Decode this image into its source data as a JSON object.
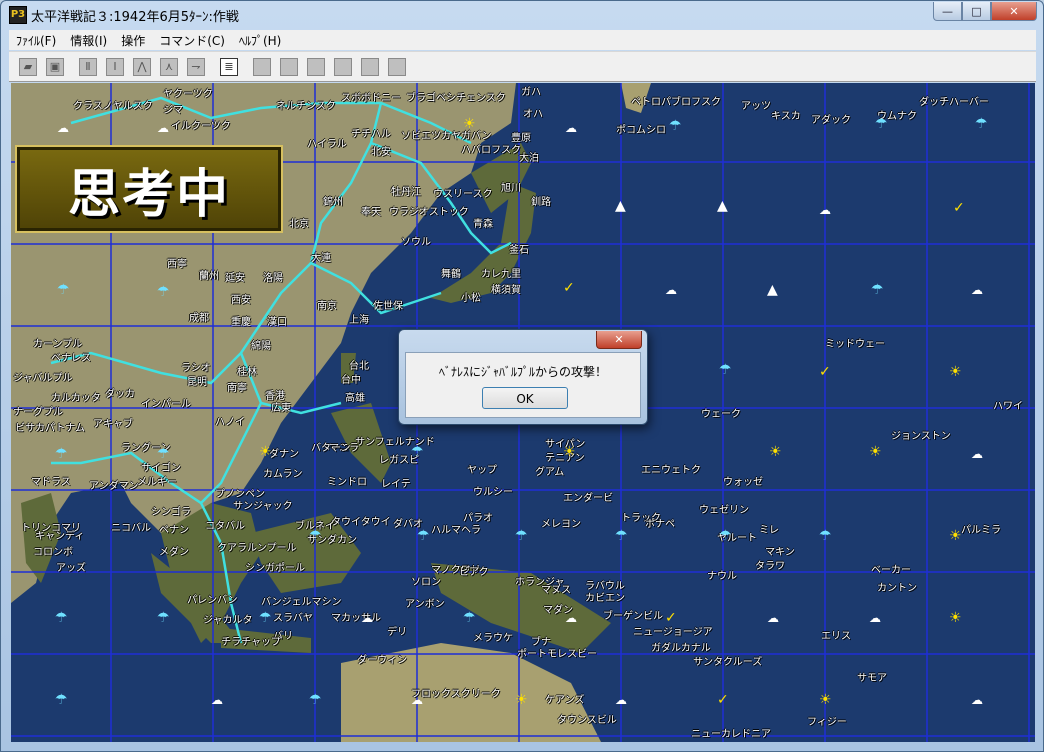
{
  "window": {
    "title": "太平洋戦記３:1942年6月5ﾀｰﾝ:作戦",
    "app_icon_text": "P3",
    "controls": {
      "minimize": "—",
      "maximize": "□",
      "close": "✕"
    }
  },
  "menu": [
    {
      "label": "ﾌｧｲﾙ(F)"
    },
    {
      "label": "情報(I)"
    },
    {
      "label": "操作"
    },
    {
      "label": "コマンド(C)"
    },
    {
      "label": "ﾍﾙﾌﾟ(H)"
    }
  ],
  "toolbar": {
    "buttons": [
      {
        "name": "open-icon",
        "glyph": "▰"
      },
      {
        "name": "save-icon",
        "glyph": "▣"
      },
      {
        "name": "unit-list-icon",
        "glyph": "Ⅱ"
      },
      {
        "name": "unit-list2-icon",
        "glyph": "Ⅰ"
      },
      {
        "name": "move-icon",
        "glyph": "⋀"
      },
      {
        "name": "move2-icon",
        "glyph": "⋏"
      },
      {
        "name": "arrow-icon",
        "glyph": "⇁"
      },
      {
        "name": "document-icon",
        "glyph": "≣"
      },
      {
        "name": "blank1-icon",
        "glyph": ""
      },
      {
        "name": "blank2-icon",
        "glyph": ""
      },
      {
        "name": "blank3-icon",
        "glyph": ""
      },
      {
        "name": "blank4-icon",
        "glyph": ""
      },
      {
        "name": "blank5-icon",
        "glyph": ""
      },
      {
        "name": "blank6-icon",
        "glyph": ""
      }
    ]
  },
  "status_overlay": {
    "text": "思考中"
  },
  "dialog": {
    "close": "✕",
    "message": "ﾍﾞﾅﾚｽにｼﾞｬﾊﾞﾙﾌﾟﾙからの攻撃！",
    "ok_label": "OK"
  },
  "map": {
    "place_labels": [
      {
        "text": "ヤクーツク"
      },
      {
        "text": "ガハ"
      },
      {
        "text": "ペトロパブロフスク"
      },
      {
        "text": "アッツ"
      },
      {
        "text": "キスカ"
      },
      {
        "text": "アダック"
      },
      {
        "text": "ウムナク"
      },
      {
        "text": "ダッチハーバー"
      },
      {
        "text": "クラスノヤルスク"
      },
      {
        "text": "ジマ"
      },
      {
        "text": "イルクーツク"
      },
      {
        "text": "ネルチンスク"
      },
      {
        "text": "スボボドニー"
      },
      {
        "text": "ブラゴベシチェンスク"
      },
      {
        "text": "ハバロフスク"
      },
      {
        "text": "ソビエツカヤガバン"
      },
      {
        "text": "オハ"
      },
      {
        "text": "ポコムシロ"
      },
      {
        "text": "大泊"
      },
      {
        "text": "豊原"
      },
      {
        "text": "ハイラル"
      },
      {
        "text": "チチハル"
      },
      {
        "text": "北安"
      },
      {
        "text": "牡丹江"
      },
      {
        "text": "ウスリースク"
      },
      {
        "text": "ウラジオストック"
      },
      {
        "text": "旭川"
      },
      {
        "text": "釧路"
      },
      {
        "text": "青森"
      },
      {
        "text": "錦州"
      },
      {
        "text": "奉天"
      },
      {
        "text": "北京"
      },
      {
        "text": "大連"
      },
      {
        "text": "ソウル"
      },
      {
        "text": "釜石"
      },
      {
        "text": "舞鶴"
      },
      {
        "text": "カレ九里"
      },
      {
        "text": "横須賀"
      },
      {
        "text": "佐世保"
      },
      {
        "text": "小松"
      },
      {
        "text": "西寧"
      },
      {
        "text": "蘭州"
      },
      {
        "text": "延安"
      },
      {
        "text": "洛陽"
      },
      {
        "text": "西安"
      },
      {
        "text": "南京"
      },
      {
        "text": "上海"
      },
      {
        "text": "成都"
      },
      {
        "text": "重慶"
      },
      {
        "text": "漢口"
      },
      {
        "text": "綿陽"
      },
      {
        "text": "ミッドウェー"
      },
      {
        "text": "カーンプル"
      },
      {
        "text": "ベナレス"
      },
      {
        "text": "ジャバルプル"
      },
      {
        "text": "カルカッタ"
      },
      {
        "text": "ダッカ"
      },
      {
        "text": "インパール"
      },
      {
        "text": "ラシオ"
      },
      {
        "text": "昆明"
      },
      {
        "text": "桂林"
      },
      {
        "text": "台北"
      },
      {
        "text": "台中"
      },
      {
        "text": "高雄"
      },
      {
        "text": "香港"
      },
      {
        "text": "広東"
      },
      {
        "text": "南寧"
      },
      {
        "text": "ウェーク"
      },
      {
        "text": "ハワイ"
      },
      {
        "text": "ナーグプル"
      },
      {
        "text": "ビサカパトナム"
      },
      {
        "text": "アキャブ"
      },
      {
        "text": "ラングーン"
      },
      {
        "text": "ハノイ"
      },
      {
        "text": "ダナン"
      },
      {
        "text": "マニラ"
      },
      {
        "text": "バターン"
      },
      {
        "text": "サンフェルナンド"
      },
      {
        "text": "レガスピ"
      },
      {
        "text": "ミンドロ"
      },
      {
        "text": "レイテ"
      },
      {
        "text": "サイパン"
      },
      {
        "text": "テニアン"
      },
      {
        "text": "グアム"
      },
      {
        "text": "ヤップ"
      },
      {
        "text": "エニウェトク"
      },
      {
        "text": "ウォッゼ"
      },
      {
        "text": "ジョンストン"
      },
      {
        "text": "マドラス"
      },
      {
        "text": "アンダマン"
      },
      {
        "text": "メルギー"
      },
      {
        "text": "サイゴン"
      },
      {
        "text": "カムラン"
      },
      {
        "text": "プノンペン"
      },
      {
        "text": "サンジャック"
      },
      {
        "text": "ウルシー"
      },
      {
        "text": "エンダービ"
      },
      {
        "text": "ウェゼリン"
      },
      {
        "text": "トリンコマリ"
      },
      {
        "text": "キャンディ"
      },
      {
        "text": "コロンボ"
      },
      {
        "text": "アッズ"
      },
      {
        "text": "ニコバル"
      },
      {
        "text": "シンゴラ"
      },
      {
        "text": "ペナン"
      },
      {
        "text": "コタバル"
      },
      {
        "text": "クアラルンプール"
      },
      {
        "text": "メダン"
      },
      {
        "text": "ブルネイ"
      },
      {
        "text": "サンダカン"
      },
      {
        "text": "シンガポール"
      },
      {
        "text": "タウイタウイ"
      },
      {
        "text": "ダバオ"
      },
      {
        "text": "ハルマヘラ"
      },
      {
        "text": "パラオ"
      },
      {
        "text": "メレヨン"
      },
      {
        "text": "トラック"
      },
      {
        "text": "ポナペ"
      },
      {
        "text": "ヤルート"
      },
      {
        "text": "マキン"
      },
      {
        "text": "タラワ"
      },
      {
        "text": "ミレ"
      },
      {
        "text": "パルミラ"
      },
      {
        "text": "ベーカー"
      },
      {
        "text": "ナウル"
      },
      {
        "text": "パレンバン"
      },
      {
        "text": "バンジェルマシン"
      },
      {
        "text": "スラバヤ"
      },
      {
        "text": "ジャカルタ"
      },
      {
        "text": "バリ"
      },
      {
        "text": "チラチャップ"
      },
      {
        "text": "マカッサル"
      },
      {
        "text": "アンボン"
      },
      {
        "text": "ソロン"
      },
      {
        "text": "マノクワリ"
      },
      {
        "text": "ビアク"
      },
      {
        "text": "ホランジャ"
      },
      {
        "text": "マダン"
      },
      {
        "text": "ラバウル"
      },
      {
        "text": "ブーゲンビル"
      },
      {
        "text": "ニュージョージア"
      },
      {
        "text": "ガダルカナル"
      },
      {
        "text": "カビエン"
      },
      {
        "text": "マヌス"
      },
      {
        "text": "エリス"
      },
      {
        "text": "カントン"
      },
      {
        "text": "デリ"
      },
      {
        "text": "ダーウィン"
      },
      {
        "text": "メラウケ"
      },
      {
        "text": "ブナ"
      },
      {
        "text": "ポートモレスビー"
      },
      {
        "text": "サンタクルーズ"
      },
      {
        "text": "サモア"
      },
      {
        "text": "ケアンズ"
      },
      {
        "text": "タウンスビル"
      },
      {
        "text": "ニューカレドニア"
      },
      {
        "text": "フィジー"
      },
      {
        "text": "フロックスクリーク"
      }
    ],
    "weather": [
      {
        "type": "sun",
        "glyph": "☀"
      },
      {
        "type": "cloud",
        "glyph": "☁"
      },
      {
        "type": "rain",
        "glyph": "☂"
      },
      {
        "type": "storm",
        "glyph": "▲"
      },
      {
        "type": "lightning",
        "glyph": "✓"
      }
    ],
    "colors": {
      "ocean": "#1c3a6e",
      "grid": "#1e2ed6",
      "route": "#40e0e0",
      "land_light": "#a8a070",
      "land_dark": "#5e6a3a",
      "city": "#ffffff"
    }
  }
}
